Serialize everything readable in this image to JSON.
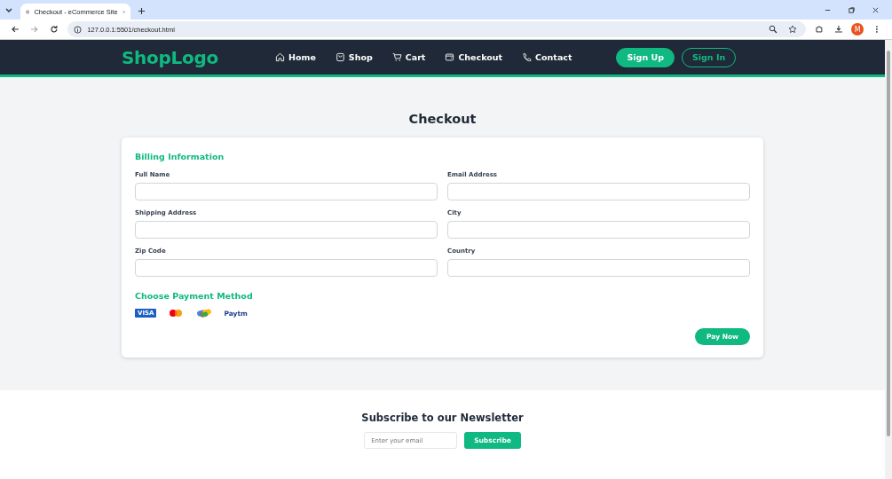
{
  "browser": {
    "tab_title": "Checkout - eCommerce Site",
    "url": "127.0.0.1:5501/checkout.html",
    "profile": "M"
  },
  "nav": {
    "logo": "ShopLogo",
    "links": [
      {
        "label": "Home",
        "kind": "home"
      },
      {
        "label": "Shop",
        "kind": "bag"
      },
      {
        "label": "Cart",
        "kind": "cart"
      },
      {
        "label": "Checkout",
        "kind": "wallet"
      },
      {
        "label": "Contact",
        "kind": "phone"
      }
    ],
    "buttons": [
      {
        "label": "Sign Up",
        "kind": "filled"
      },
      {
        "label": "Sign In",
        "kind": "outline"
      }
    ]
  },
  "page_title": "Checkout",
  "billing": {
    "title": "Billing Information",
    "fields": [
      {
        "label": "Full Name"
      },
      {
        "label": "Email Address"
      },
      {
        "label": "Shipping Address"
      },
      {
        "label": "City"
      },
      {
        "label": "Zip Code"
      },
      {
        "label": "Country"
      }
    ]
  },
  "payment": {
    "title": "Choose Payment Method",
    "methods": [
      {
        "kind": "visa",
        "label": "VISA"
      },
      {
        "kind": "mastercard"
      },
      {
        "kind": "gpay"
      },
      {
        "kind": "paytm",
        "label": "Paytm"
      }
    ],
    "button": "Pay Now"
  },
  "newsletter": {
    "title": "Subscribe to our Newsletter",
    "placeholder": "Enter your email",
    "button": "Subscribe"
  }
}
